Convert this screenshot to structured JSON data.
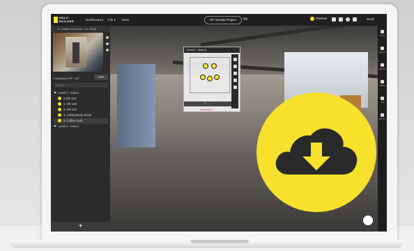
{
  "app": {
    "logo_line1": "HOLO",
    "logo_line2": "BUILDER",
    "menu": {
      "dashboard": "Dashboard ▸",
      "file": "File ▾",
      "save": "Save"
    },
    "project": "HP Sample Project",
    "preview": "Preview",
    "user": "Scott"
  },
  "left_panel": {
    "header": "5. Coffee nook (Jan... to, 2018)",
    "displaying": "Displaying 043 / 043",
    "filter": "Filter",
    "search_placeholder": "Search",
    "tree": [
      {
        "label": "Level 1 : Area A",
        "type": "group"
      },
      {
        "label": "1.OR 124",
        "type": "item"
      },
      {
        "label": "2. OR 123",
        "type": "item"
      },
      {
        "label": "3. OR 122",
        "type": "item"
      },
      {
        "label": "4. Lobby/Study Room",
        "type": "item"
      },
      {
        "label": "5. Coffee nook",
        "type": "item",
        "selected": true
      },
      {
        "label": "Level 2 : Area A",
        "type": "group"
      }
    ],
    "add_button": "+"
  },
  "minimap": {
    "title": "Level 1 : Area A",
    "footer": "Ⓘ   ...   ...",
    "warning": "Level and 1 ..."
  },
  "right_bar": {
    "items": [
      "Notes",
      "Measure",
      "Markup",
      "Settings",
      "Full",
      "DC Photos"
    ]
  },
  "overlay": {
    "icon": "cloud-download-icon",
    "color": "#f7e12c"
  }
}
